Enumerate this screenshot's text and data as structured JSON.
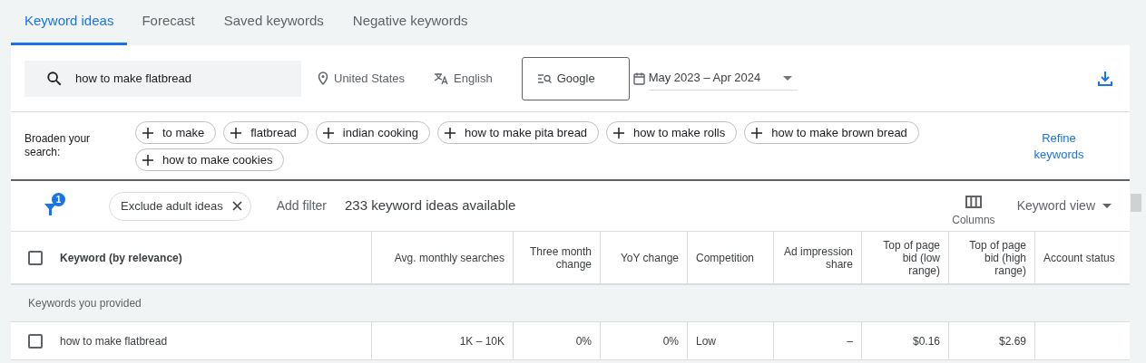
{
  "tabs": [
    {
      "label": "Keyword ideas",
      "selected": true
    },
    {
      "label": "Forecast",
      "selected": false
    },
    {
      "label": "Saved keywords",
      "selected": false
    },
    {
      "label": "Negative keywords",
      "selected": false
    }
  ],
  "search": {
    "value": "how to make flatbread",
    "location": "United States",
    "language": "English",
    "network": "Google",
    "date_range": "May 2023 – Apr 2024"
  },
  "broaden": {
    "label": "Broaden your search:",
    "chips": [
      "to make",
      "flatbread",
      "indian cooking",
      "how to make pita bread",
      "how to make rolls",
      "how to make brown bread",
      "how to make cookies"
    ],
    "refine": "Refine keywords"
  },
  "filters": {
    "badge": "1",
    "chip": "Exclude adult ideas",
    "add": "Add filter",
    "count": "233 keyword ideas available",
    "columns": "Columns",
    "view": "Keyword view"
  },
  "table": {
    "columns": [
      "Keyword (by relevance)",
      "Avg. monthly searches",
      "Three month change",
      "YoY change",
      "Competition",
      "Ad impression share",
      "Top of page bid (low range)",
      "Top of page bid (high range)",
      "Account status"
    ],
    "all_checked": false,
    "group": "Keywords you provided",
    "rows": [
      {
        "checked": false,
        "cells": [
          "how to make flatbread",
          "1K – 10K",
          "0%",
          "0%",
          "Low",
          "–",
          "$0.16",
          "$2.69"
        ]
      }
    ]
  }
}
